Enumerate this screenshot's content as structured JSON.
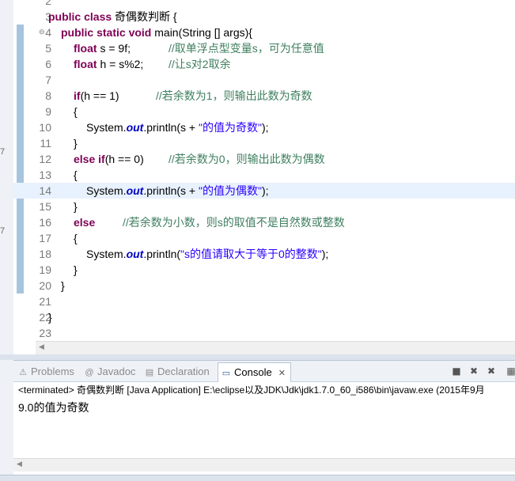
{
  "left_strip": {
    "marks": [
      "7",
      "7"
    ]
  },
  "editor": {
    "lines": [
      {
        "num": "2"
      },
      {
        "num": "3"
      },
      {
        "num": "4"
      },
      {
        "num": "5"
      },
      {
        "num": "6"
      },
      {
        "num": "7"
      },
      {
        "num": "8"
      },
      {
        "num": "9"
      },
      {
        "num": "10"
      },
      {
        "num": "11"
      },
      {
        "num": "12"
      },
      {
        "num": "13"
      },
      {
        "num": "14"
      },
      {
        "num": "15"
      },
      {
        "num": "16"
      },
      {
        "num": "17"
      },
      {
        "num": "18"
      },
      {
        "num": "19"
      },
      {
        "num": "20"
      },
      {
        "num": "21"
      },
      {
        "num": "22"
      },
      {
        "num": "23"
      }
    ],
    "code": {
      "l3": {
        "kw": "public class",
        "rest": " 奇偶数判断 {"
      },
      "l4": {
        "kw": "public static void",
        "rest": " main(String [] args){"
      },
      "l5": {
        "kw": "float",
        "rest": " s = 9f;",
        "cmt": "//取单浮点型变量s，可为任意值"
      },
      "l6": {
        "kw": "float",
        "rest": " h = s%2;",
        "cmt": "//让s对2取余"
      },
      "l8": {
        "kw": "if",
        "rest": "(h == 1)",
        "cmt": "//若余数为1，则输出此数为奇数"
      },
      "l9": {
        "text": "{"
      },
      "l10": {
        "pre": "System.",
        "fld": "out",
        "mid": ".println(s + ",
        "str": "\"的值为奇数\"",
        "post": ");"
      },
      "l11": {
        "text": "}"
      },
      "l12": {
        "kw": "else if",
        "rest": "(h == 0)",
        "cmt": "//若余数为0，则输出此数为偶数"
      },
      "l13": {
        "text": "{"
      },
      "l14": {
        "pre": "System.",
        "fld": "out",
        "mid": ".println(s + ",
        "str": "\"的值为偶数\"",
        "post": ");"
      },
      "l15": {
        "text": "}"
      },
      "l16": {
        "kw": "else",
        "cmt": "//若余数为小数，则s的取值不是自然数或整数"
      },
      "l17": {
        "text": "{"
      },
      "l18": {
        "pre": "System.",
        "fld": "out",
        "mid": ".println(",
        "str": "\"s的值请取大于等于0的整数\"",
        "post": ");"
      },
      "l19": {
        "text": "}"
      },
      "l20": {
        "text": "}"
      },
      "l22": {
        "text": "}"
      }
    }
  },
  "bottom_panel": {
    "tabs": [
      {
        "label": "Problems",
        "icon": "problems-icon",
        "glyph": "⚠"
      },
      {
        "label": "Javadoc",
        "icon": "javadoc-icon",
        "glyph": "@"
      },
      {
        "label": "Declaration",
        "icon": "declaration-icon",
        "glyph": "▤"
      },
      {
        "label": "Console",
        "icon": "console-icon",
        "glyph": "▭",
        "close": "✕"
      }
    ],
    "console_title": "<terminated> 奇偶数判断 [Java Application] E:\\eclipse以及JDK\\Jdk\\jdk1.7.0_60_i586\\bin\\javaw.exe (2015年9月",
    "output": "9.0的值为奇数"
  },
  "colors": {
    "keyword": "#7f0055",
    "string": "#2a00ff",
    "comment": "#3f7f5f",
    "field": "#0000c0",
    "current_line": "#e8f2fe"
  }
}
